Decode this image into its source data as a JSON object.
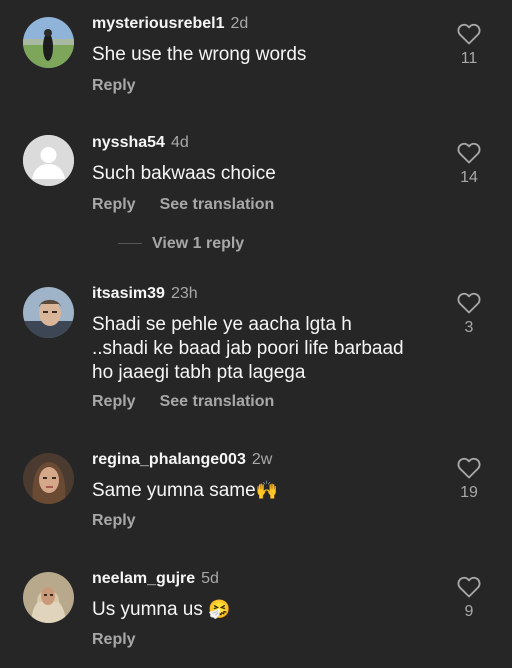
{
  "comments": [
    {
      "username": "mysteriousrebel1",
      "time": "2d",
      "text": "She use the wrong words",
      "reply_label": "Reply",
      "likes": "11"
    },
    {
      "username": "nyssha54",
      "time": "4d",
      "text": "Such bakwaas choice",
      "reply_label": "Reply",
      "translation_label": "See translation",
      "likes": "14",
      "view_replies_label": "View 1 reply"
    },
    {
      "username": "itsasim39",
      "time": "23h",
      "text": "Shadi se pehle ye aacha lgta h ..shadi ke baad jab poori life barbaad ho jaaegi tabh pta lagega",
      "reply_label": "Reply",
      "translation_label": "See translation",
      "likes": "3"
    },
    {
      "username": "regina_phalange003",
      "time": "2w",
      "text": "Same yumna same",
      "emoji": "🙌",
      "reply_label": "Reply",
      "likes": "19"
    },
    {
      "username": "neelam_gujre",
      "time": "5d",
      "text": "Us yumna us ",
      "emoji": "🤧",
      "reply_label": "Reply",
      "likes": "9"
    }
  ],
  "colors": {
    "background": "#262626",
    "primary_text": "#f5f5f5",
    "secondary_text": "#a8a8a8"
  },
  "icons": {
    "like": "heart-outline-icon",
    "default_avatar": "default-avatar-icon"
  }
}
